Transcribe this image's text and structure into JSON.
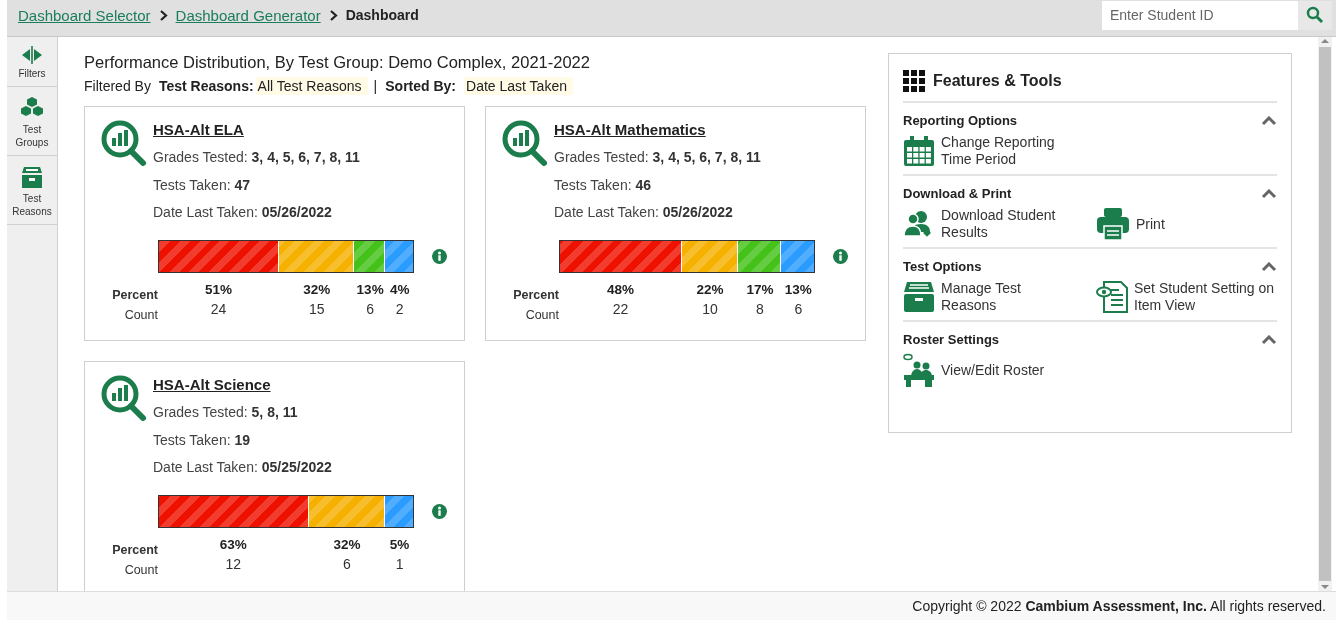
{
  "breadcrumbs": [
    {
      "label": "Dashboard Selector",
      "kind": "link"
    },
    {
      "label": "Dashboard Generator",
      "kind": "link"
    },
    {
      "label": "Dashboard",
      "kind": "current"
    }
  ],
  "search": {
    "placeholder": "Enter Student ID"
  },
  "sidebar": {
    "items": [
      {
        "label": "Filters"
      },
      {
        "label": "Test Groups"
      },
      {
        "label": "Test Reasons"
      }
    ]
  },
  "header": {
    "title": "Performance Distribution, By Test Group: Demo Complex, 2021-2022",
    "filtered_by": "Filtered By",
    "filter_label": "Test Reasons:",
    "filter_value": "All Test Reasons",
    "separator": "|",
    "sort_label": "Sorted By:",
    "sort_value": "Date Last Taken"
  },
  "cards": [
    {
      "title": "HSA-Alt ELA",
      "fields": [
        {
          "label": "Grades Tested:",
          "value": "3, 4, 5, 6, 7, 8, 11"
        },
        {
          "label": "Tests Taken:",
          "value": "47"
        },
        {
          "label": "Date Last Taken:",
          "value": "05/26/2022"
        }
      ],
      "percent_label": "Percent",
      "count_label": "Count",
      "segments": [
        {
          "color": "#ee1100",
          "percent": "51%",
          "count": "24"
        },
        {
          "color": "#f5b000",
          "percent": "32%",
          "count": "15"
        },
        {
          "color": "#44c21a",
          "percent": "13%",
          "count": "6"
        },
        {
          "color": "#2b9cff",
          "percent": "4%",
          "count": "2"
        }
      ]
    },
    {
      "title": "HSA-Alt Mathematics",
      "fields": [
        {
          "label": "Grades Tested:",
          "value": "3, 4, 5, 6, 7, 8, 11"
        },
        {
          "label": "Tests Taken:",
          "value": "46"
        },
        {
          "label": "Date Last Taken:",
          "value": "05/26/2022"
        }
      ],
      "percent_label": "Percent",
      "count_label": "Count",
      "segments": [
        {
          "color": "#ee1100",
          "percent": "48%",
          "count": "22"
        },
        {
          "color": "#f5b000",
          "percent": "22%",
          "count": "10"
        },
        {
          "color": "#44c21a",
          "percent": "17%",
          "count": "8"
        },
        {
          "color": "#2b9cff",
          "percent": "13%",
          "count": "6"
        }
      ]
    },
    {
      "title": "HSA-Alt Science",
      "fields": [
        {
          "label": "Grades Tested:",
          "value": "5, 8, 11"
        },
        {
          "label": "Tests Taken:",
          "value": "19"
        },
        {
          "label": "Date Last Taken:",
          "value": "05/25/2022"
        }
      ],
      "percent_label": "Percent",
      "count_label": "Count",
      "segments": [
        {
          "color": "#ee1100",
          "percent": "63%",
          "count": "12"
        },
        {
          "color": "#f5b000",
          "percent": "32%",
          "count": "6"
        },
        {
          "color": "#2b9cff",
          "percent": "5%",
          "count": "1"
        }
      ]
    }
  ],
  "features": {
    "title": "Features & Tools",
    "sections": [
      {
        "title": "Reporting Options",
        "expanded": true,
        "tools": [
          {
            "label": "Change Reporting Time Period"
          }
        ]
      },
      {
        "title": "Download & Print",
        "expanded": true,
        "tools": [
          {
            "label": "Download Student Results"
          },
          {
            "label": "Print"
          }
        ]
      },
      {
        "title": "Test Options",
        "expanded": true,
        "tools": [
          {
            "label": "Manage Test Reasons"
          },
          {
            "label": "Set Student Setting on Item View"
          }
        ]
      },
      {
        "title": "Roster Settings",
        "expanded": true,
        "tools": [
          {
            "label": "View/Edit Roster"
          }
        ]
      }
    ]
  },
  "footer": "Copyright © 2022 **Cambium Assessment, Inc.** All rights reserved."
}
